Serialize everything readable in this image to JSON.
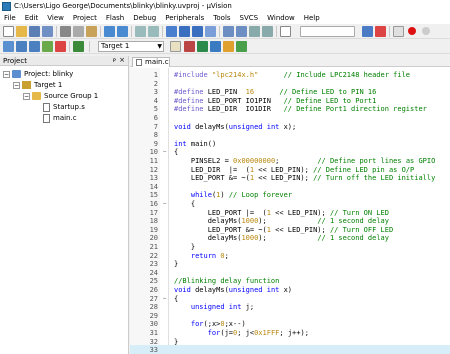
{
  "window": {
    "title": "C:\\Users\\Ligo George\\Documents\\blinky\\blinky.uvproj - µVision"
  },
  "menu": [
    "File",
    "Edit",
    "View",
    "Project",
    "Flash",
    "Debug",
    "Peripherals",
    "Tools",
    "SVCS",
    "Window",
    "Help"
  ],
  "toolbar": {
    "target_select": "Target 1"
  },
  "project_panel": {
    "title": "Project",
    "pin_icon": "pin-icon",
    "close_icon": "close-icon",
    "tree": {
      "project": "Project: blinky",
      "target": "Target 1",
      "group": "Source Group 1",
      "files": [
        "Startup.s",
        "main.c"
      ]
    }
  },
  "editor": {
    "tab": "main.c",
    "current_line": 33,
    "lines": [
      {
        "n": "1",
        "fold": "",
        "tokens": [
          {
            "c": "pp",
            "t": "#include "
          },
          {
            "c": "nm",
            "t": "\"lpc214x.h\""
          },
          {
            "c": "",
            "t": "      "
          },
          {
            "c": "cm",
            "t": "// Include LPC2148 header file"
          }
        ]
      },
      {
        "n": "2",
        "fold": "",
        "tokens": []
      },
      {
        "n": "3",
        "fold": "",
        "tokens": [
          {
            "c": "pp",
            "t": "#define "
          },
          {
            "c": "",
            "t": "LED_PIN  "
          },
          {
            "c": "nm",
            "t": "16"
          },
          {
            "c": "",
            "t": "      "
          },
          {
            "c": "cm",
            "t": "// Define LED to PIN 16"
          }
        ]
      },
      {
        "n": "4",
        "fold": "",
        "tokens": [
          {
            "c": "pp",
            "t": "#define "
          },
          {
            "c": "",
            "t": "LED_PORT IO1PIN   "
          },
          {
            "c": "cm",
            "t": "// Define LED to Port1"
          }
        ]
      },
      {
        "n": "5",
        "fold": "",
        "tokens": [
          {
            "c": "pp",
            "t": "#define "
          },
          {
            "c": "",
            "t": "LED_DIR  IO1DIR   "
          },
          {
            "c": "cm",
            "t": "// Define Port1 direction register"
          }
        ]
      },
      {
        "n": "6",
        "fold": "",
        "tokens": []
      },
      {
        "n": "7",
        "fold": "",
        "tokens": [
          {
            "c": "kw",
            "t": "void"
          },
          {
            "c": "",
            "t": " delayMs("
          },
          {
            "c": "kw",
            "t": "unsigned int"
          },
          {
            "c": "",
            "t": " x);"
          }
        ]
      },
      {
        "n": "8",
        "fold": "",
        "tokens": []
      },
      {
        "n": "9",
        "fold": "",
        "tokens": [
          {
            "c": "kw",
            "t": "int"
          },
          {
            "c": "",
            "t": " main()"
          }
        ]
      },
      {
        "n": "10",
        "fold": "−",
        "tokens": [
          {
            "c": "",
            "t": "{"
          }
        ]
      },
      {
        "n": "11",
        "fold": "",
        "tokens": [
          {
            "c": "",
            "t": "    PINSEL2 = "
          },
          {
            "c": "nm",
            "t": "0x00000000"
          },
          {
            "c": "",
            "t": ";         "
          },
          {
            "c": "cm",
            "t": "// Define port lines as GPIO"
          }
        ]
      },
      {
        "n": "12",
        "fold": "",
        "tokens": [
          {
            "c": "",
            "t": "    LED_DIR  |=  ("
          },
          {
            "c": "nm",
            "t": "1"
          },
          {
            "c": "",
            "t": " << LED_PIN); "
          },
          {
            "c": "cm",
            "t": "// Define LED pin as O/P"
          }
        ]
      },
      {
        "n": "13",
        "fold": "",
        "tokens": [
          {
            "c": "",
            "t": "    LED_PORT &= ~("
          },
          {
            "c": "nm",
            "t": "1"
          },
          {
            "c": "",
            "t": " << LED_PIN); "
          },
          {
            "c": "cm",
            "t": "// Turn off the LED initially"
          }
        ]
      },
      {
        "n": "14",
        "fold": "",
        "tokens": []
      },
      {
        "n": "15",
        "fold": "",
        "tokens": [
          {
            "c": "",
            "t": "    "
          },
          {
            "c": "kw",
            "t": "while"
          },
          {
            "c": "",
            "t": "("
          },
          {
            "c": "nm",
            "t": "1"
          },
          {
            "c": "",
            "t": ") "
          },
          {
            "c": "cm",
            "t": "// Loop forever"
          }
        ]
      },
      {
        "n": "16",
        "fold": "−",
        "tokens": [
          {
            "c": "",
            "t": "    {"
          }
        ]
      },
      {
        "n": "17",
        "fold": "",
        "tokens": [
          {
            "c": "",
            "t": "        LED_PORT |=  ("
          },
          {
            "c": "nm",
            "t": "1"
          },
          {
            "c": "",
            "t": " << LED_PIN); "
          },
          {
            "c": "cm",
            "t": "// Turn ON LED"
          }
        ]
      },
      {
        "n": "18",
        "fold": "",
        "tokens": [
          {
            "c": "",
            "t": "        delayMs("
          },
          {
            "c": "nm",
            "t": "1000"
          },
          {
            "c": "",
            "t": ");            "
          },
          {
            "c": "cm",
            "t": "// 1 second delay"
          }
        ]
      },
      {
        "n": "19",
        "fold": "",
        "tokens": [
          {
            "c": "",
            "t": "        LED_PORT &= ~("
          },
          {
            "c": "nm",
            "t": "1"
          },
          {
            "c": "",
            "t": " << LED_PIN); "
          },
          {
            "c": "cm",
            "t": "// Turn OFF LED"
          }
        ]
      },
      {
        "n": "20",
        "fold": "",
        "tokens": [
          {
            "c": "",
            "t": "        delayMs("
          },
          {
            "c": "nm",
            "t": "1000"
          },
          {
            "c": "",
            "t": ");            "
          },
          {
            "c": "cm",
            "t": "// 1 second delay"
          }
        ]
      },
      {
        "n": "21",
        "fold": "",
        "tokens": [
          {
            "c": "",
            "t": "    }"
          }
        ]
      },
      {
        "n": "22",
        "fold": "",
        "tokens": [
          {
            "c": "",
            "t": "    "
          },
          {
            "c": "kw",
            "t": "return"
          },
          {
            "c": "",
            "t": " "
          },
          {
            "c": "nm",
            "t": "0"
          },
          {
            "c": "",
            "t": ";"
          }
        ]
      },
      {
        "n": "23",
        "fold": "",
        "tokens": [
          {
            "c": "",
            "t": "}"
          }
        ]
      },
      {
        "n": "24",
        "fold": "",
        "tokens": []
      },
      {
        "n": "25",
        "fold": "",
        "tokens": [
          {
            "c": "cm",
            "t": "//Blinking delay function"
          }
        ]
      },
      {
        "n": "26",
        "fold": "",
        "tokens": [
          {
            "c": "kw",
            "t": "void"
          },
          {
            "c": "",
            "t": " delayMs("
          },
          {
            "c": "kw",
            "t": "unsigned int"
          },
          {
            "c": "",
            "t": " x)"
          }
        ]
      },
      {
        "n": "27",
        "fold": "−",
        "tokens": [
          {
            "c": "",
            "t": "{"
          }
        ]
      },
      {
        "n": "28",
        "fold": "",
        "tokens": [
          {
            "c": "",
            "t": "    "
          },
          {
            "c": "kw",
            "t": "unsigned int"
          },
          {
            "c": "",
            "t": " j;"
          }
        ]
      },
      {
        "n": "29",
        "fold": "",
        "tokens": []
      },
      {
        "n": "30",
        "fold": "",
        "tokens": [
          {
            "c": "",
            "t": "    "
          },
          {
            "c": "kw",
            "t": "for"
          },
          {
            "c": "",
            "t": "(;x>"
          },
          {
            "c": "nm",
            "t": "0"
          },
          {
            "c": "",
            "t": ";x--)"
          }
        ]
      },
      {
        "n": "31",
        "fold": "",
        "tokens": [
          {
            "c": "",
            "t": "        "
          },
          {
            "c": "kw",
            "t": "for"
          },
          {
            "c": "",
            "t": "(j="
          },
          {
            "c": "nm",
            "t": "0"
          },
          {
            "c": "",
            "t": "; j<"
          },
          {
            "c": "nm",
            "t": "0x1FFF"
          },
          {
            "c": "",
            "t": "; j++);"
          }
        ]
      },
      {
        "n": "32",
        "fold": "",
        "tokens": [
          {
            "c": "",
            "t": "}"
          }
        ]
      },
      {
        "n": "33",
        "fold": "",
        "tokens": []
      }
    ]
  }
}
